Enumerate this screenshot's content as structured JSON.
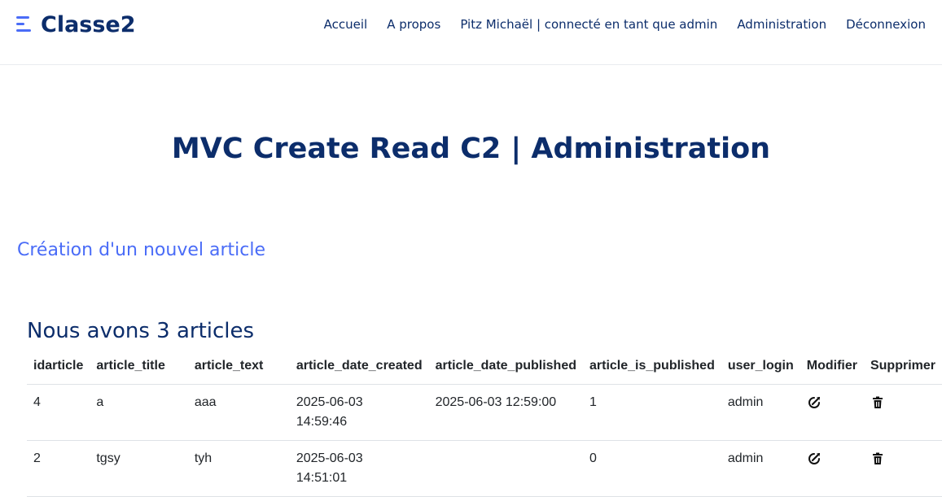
{
  "brand": {
    "name": "Classe2",
    "accent": "#4a6cf7",
    "primary": "#0c2d6b"
  },
  "nav": {
    "items": [
      "Accueil",
      "A propos",
      "Pitz Michaël | connecté en tant que admin",
      "Administration",
      "Déconnexion"
    ]
  },
  "main": {
    "title": "MVC Create Read C2 | Administration",
    "create_link": "Création d'un nouvel article",
    "count_text": "Nous avons 3 articles"
  },
  "table": {
    "headers": [
      "idarticle",
      "article_title",
      "article_text",
      "article_date_created",
      "article_date_published",
      "article_is_published",
      "user_login",
      "Modifier",
      "Supprimer"
    ],
    "rows": [
      {
        "idarticle": "4",
        "article_title": "a",
        "article_text": "aaa",
        "date_created_date": "2025-06-03",
        "date_created_time": "14:59:46",
        "article_date_published": "2025-06-03 12:59:00",
        "article_is_published": "1",
        "user_login": "admin",
        "edit_icon": "edit-icon",
        "delete_icon": "trash-icon"
      },
      {
        "idarticle": "2",
        "article_title": "tgsy",
        "article_text": "tyh",
        "date_created_date": "2025-06-03",
        "date_created_time": "14:51:01",
        "article_date_published": "",
        "article_is_published": "0",
        "user_login": "admin",
        "edit_icon": "edit-icon",
        "delete_icon": "trash-icon"
      }
    ]
  }
}
